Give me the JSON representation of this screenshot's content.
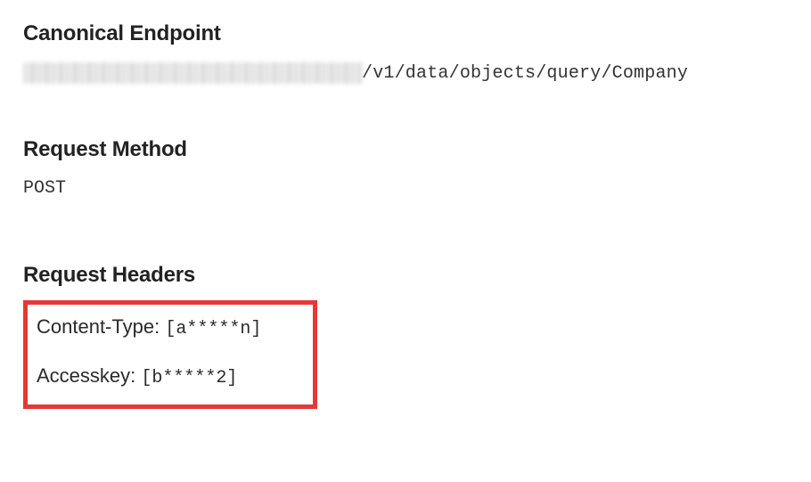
{
  "sections": {
    "endpoint": {
      "heading": "Canonical Endpoint",
      "path": "/v1/data/objects/query/Company"
    },
    "method": {
      "heading": "Request Method",
      "value": "POST"
    },
    "headers": {
      "heading": "Request Headers",
      "items": [
        {
          "name": "Content-Type:",
          "value": "[a*****n]"
        },
        {
          "name": "Accesskey:",
          "value": "[b*****2]"
        }
      ]
    }
  }
}
